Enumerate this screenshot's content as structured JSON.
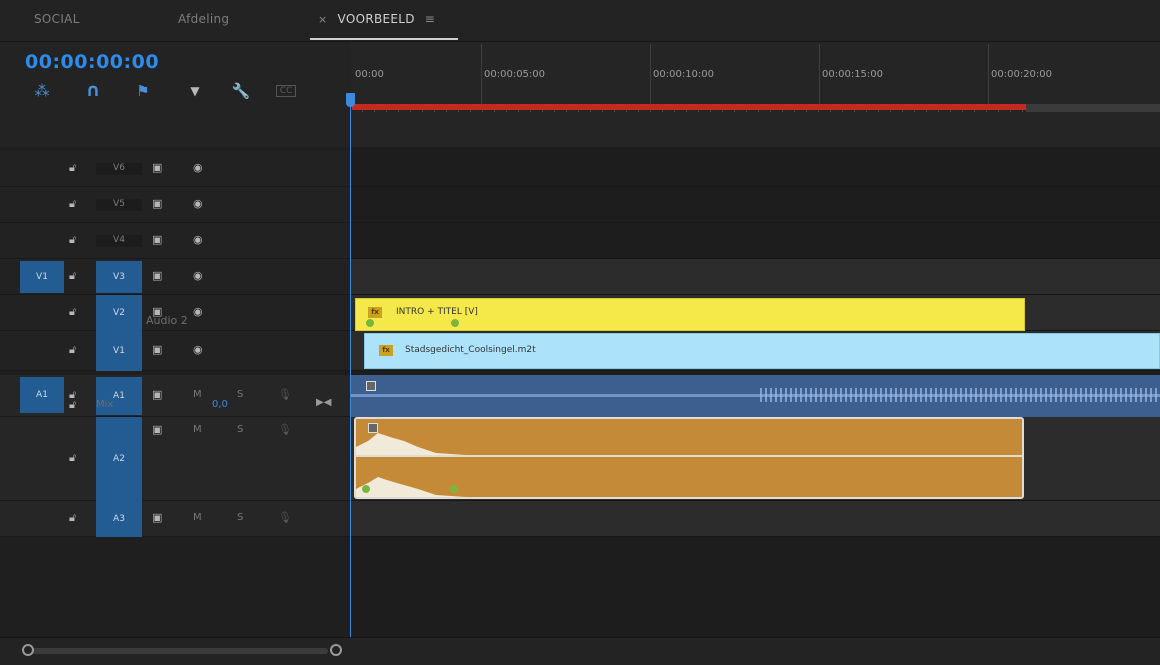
{
  "tabs": [
    {
      "label": "SOCIAL"
    },
    {
      "label": "Afdeling"
    },
    {
      "label": "VOORBEELD"
    }
  ],
  "timecode": "00:00:00:00",
  "ruler": {
    "labels": [
      "00:00",
      "00:00:05:00",
      "00:00:10:00",
      "00:00:15:00",
      "00:00:20:00"
    ]
  },
  "video_tracks": [
    {
      "name": "V6",
      "target_on": false,
      "source_patch": false
    },
    {
      "name": "V5",
      "target_on": false,
      "source_patch": false
    },
    {
      "name": "V4",
      "target_on": false,
      "source_patch": false
    },
    {
      "name": "V3",
      "target_on": true,
      "source_patch": true,
      "source_label": "V1"
    },
    {
      "name": "V2",
      "target_on": true,
      "source_patch": false
    },
    {
      "name": "V1",
      "target_on": true,
      "source_patch": false
    }
  ],
  "audio_tracks": [
    {
      "name": "A1",
      "source_label": "A1",
      "toggles": [
        "M",
        "S"
      ]
    },
    {
      "name": "A2",
      "label": "Audio 2",
      "toggles": [
        "M",
        "S"
      ]
    },
    {
      "name": "A3",
      "toggles": [
        "M",
        "S"
      ]
    }
  ],
  "mix": {
    "label": "Mix",
    "value": "0,0"
  },
  "clips": {
    "intro": {
      "name": "INTRO + TITEL [V]",
      "color": "#f5e94a"
    },
    "stadsgedicht": {
      "name": "Stadsgedicht_Coolsingel.m2t",
      "color": "#ace3fb"
    },
    "fx_badge": "fx"
  },
  "colors": {
    "accent": "#2d8ceb",
    "workarea": "#c42a20",
    "audio_clip": "#c58a37",
    "audio_a1": "#3c5f8f"
  },
  "icons": [
    "nest-icon",
    "snap-icon",
    "link-icon",
    "marker-icon",
    "wrench-icon",
    "captions-icon",
    "lock-icon",
    "film-icon",
    "eye-icon",
    "mic-icon"
  ]
}
